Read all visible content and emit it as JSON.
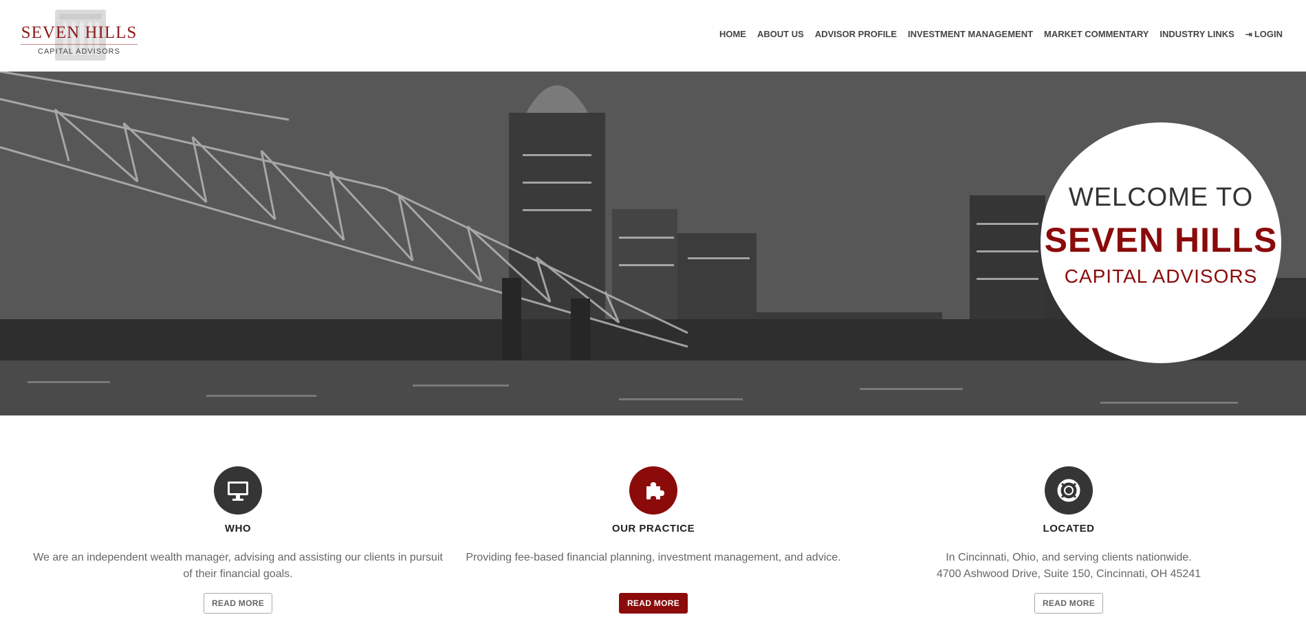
{
  "logo": {
    "title": "SEVEN HILLS",
    "subtitle": "CAPITAL ADVISORS"
  },
  "nav": {
    "items": [
      {
        "label": "HOME"
      },
      {
        "label": "ABOUT US"
      },
      {
        "label": "ADVISOR PROFILE"
      },
      {
        "label": "INVESTMENT MANAGEMENT"
      },
      {
        "label": "MARKET COMMENTARY"
      },
      {
        "label": "INDUSTRY LINKS"
      },
      {
        "label": "LOGIN",
        "icon": "sign-in-icon"
      }
    ]
  },
  "hero": {
    "line1": "WELCOME TO",
    "line2": "SEVEN HILLS",
    "line3": "CAPITAL ADVISORS"
  },
  "features": [
    {
      "icon": "monitor-icon",
      "title": "WHO",
      "text": "We are an independent wealth manager, advising and assisting our clients in pursuit of their financial goals.",
      "button": "READ MORE"
    },
    {
      "icon": "puzzle-icon",
      "title": "OUR PRACTICE",
      "text": "Providing fee-based financial planning, investment management, and advice.",
      "button": "READ MORE"
    },
    {
      "icon": "life-ring-icon",
      "title": "LOCATED",
      "text_line1": "In Cincinnati, Ohio, and serving clients nationwide.",
      "text_line2": "4700 Ashwood Drive, Suite 150, Cincinnati, OH 45241",
      "button": "READ MORE"
    }
  ],
  "colors": {
    "brand_red": "#8b0a0a",
    "icon_dark": "#353535",
    "text_gray": "#666666"
  }
}
